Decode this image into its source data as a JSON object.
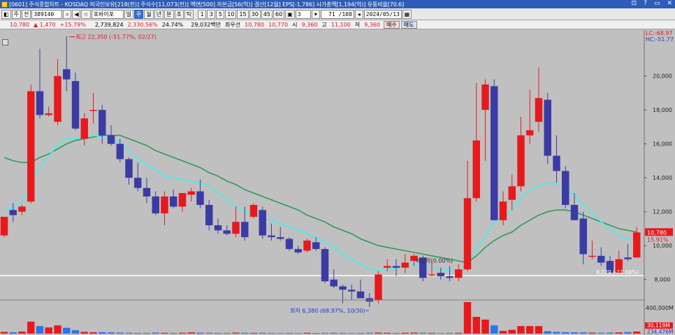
{
  "title_bar": {
    "text": "[0601] 주식종합차트 - KOSDAQ 외국인보유[218(천)] 주식수[11,073(천)] 액면[500] 자본금[56(억)] 결산[12월] EPS[-1,786] 시가총액[1,194(억)] 유통비율[70.6]",
    "controls": [
      "⊡",
      "?",
      "▭",
      "✕"
    ]
  },
  "toolbar": {
    "type_select": "주",
    "market_select": "전",
    "code": "389140",
    "search_icon": "magnifier-icon",
    "stock_name": "포바이포",
    "periods": [
      "일",
      "주",
      "월",
      "년",
      "분",
      "초",
      "틱"
    ],
    "active_period": "주",
    "intervals": [
      "1",
      "3",
      "5",
      "10",
      "15",
      "30",
      "45",
      "60"
    ],
    "interval_value": "3",
    "page_count": "71 /108",
    "date": "2024/05/13"
  },
  "quote_bar": {
    "price": "10,780",
    "change": "▲ 1,470",
    "change_pct": "+15.79%",
    "volume": "2,739,824",
    "vol_change": "2,330.56%",
    "turnover": "24.74%",
    "amount": "29,032백만",
    "label_best": "최우선",
    "best_ask": "10,780",
    "best_bid": "10,770",
    "open_label": "시",
    "open": "9,360",
    "high_label": "고",
    "high": "11,100",
    "low_label": "저",
    "low": "9,360",
    "buy_label": "매수",
    "sell_label": "매도"
  },
  "chart_data": {
    "type": "candlestick",
    "price_axis": {
      "min": 7000,
      "max": 22500,
      "ticks": [
        "20,000",
        "18,000",
        "16,000",
        "14,000",
        "12,000",
        "10,000",
        "8,000"
      ]
    },
    "volume_axis": {
      "ticks": [
        "400,000M"
      ],
      "max": 460
    },
    "annotations": {
      "high": "최고 22,350 (-51.77%, 02/27)",
      "low": "최저 6,380 (68.97%, 10/30)",
      "dividend": "배당락(0.00%)",
      "hline_label": "8,229 (-11.68%)"
    },
    "right_labels": {
      "lc": "LC:-68.97",
      "hc": "HC:-51.77",
      "current_price": "10,780",
      "current_pct": "15.91%",
      "vol_current": "30,119M",
      "vol_prev": "234,476M"
    },
    "hline_value": 8229,
    "candles": [
      {
        "o": 10600,
        "h": 11500,
        "l": 10500,
        "c": 11700
      },
      {
        "o": 12100,
        "h": 12500,
        "l": 11400,
        "c": 11800
      },
      {
        "o": 12000,
        "h": 12400,
        "l": 11800,
        "c": 12300
      },
      {
        "o": 12600,
        "h": 19500,
        "l": 12500,
        "c": 19100
      },
      {
        "o": 19100,
        "h": 21600,
        "l": 17500,
        "c": 17700
      },
      {
        "o": 17700,
        "h": 18200,
        "l": 17600,
        "c": 17800
      },
      {
        "o": 17300,
        "h": 21000,
        "l": 17100,
        "c": 20000
      },
      {
        "o": 20400,
        "h": 22350,
        "l": 19100,
        "c": 19800
      },
      {
        "o": 19700,
        "h": 20200,
        "l": 16800,
        "c": 16900
      },
      {
        "o": 16300,
        "h": 17800,
        "l": 15900,
        "c": 17500
      },
      {
        "o": 18000,
        "h": 19000,
        "l": 17200,
        "c": 18000
      },
      {
        "o": 18000,
        "h": 18300,
        "l": 16000,
        "c": 16500
      },
      {
        "o": 16500,
        "h": 17100,
        "l": 15900,
        "c": 16000
      },
      {
        "o": 16000,
        "h": 16300,
        "l": 14900,
        "c": 15100
      },
      {
        "o": 15100,
        "h": 15200,
        "l": 13600,
        "c": 14000
      },
      {
        "o": 14000,
        "h": 14900,
        "l": 13200,
        "c": 13400
      },
      {
        "o": 13400,
        "h": 14000,
        "l": 12500,
        "c": 12900
      },
      {
        "o": 12900,
        "h": 13200,
        "l": 11800,
        "c": 11900
      },
      {
        "o": 11900,
        "h": 13200,
        "l": 11200,
        "c": 12900
      },
      {
        "o": 12900,
        "h": 13300,
        "l": 12200,
        "c": 12300
      },
      {
        "o": 12300,
        "h": 13100,
        "l": 12000,
        "c": 13100
      },
      {
        "o": 13000,
        "h": 13400,
        "l": 12600,
        "c": 13200
      },
      {
        "o": 13200,
        "h": 13900,
        "l": 12200,
        "c": 12400
      },
      {
        "o": 12400,
        "h": 12700,
        "l": 10900,
        "c": 11200
      },
      {
        "o": 11200,
        "h": 11600,
        "l": 10700,
        "c": 10900
      },
      {
        "o": 10900,
        "h": 11200,
        "l": 10600,
        "c": 10700
      },
      {
        "o": 10700,
        "h": 12300,
        "l": 10500,
        "c": 11400
      },
      {
        "o": 11400,
        "h": 12300,
        "l": 10300,
        "c": 10500
      },
      {
        "o": 11700,
        "h": 12500,
        "l": 11600,
        "c": 12400
      },
      {
        "o": 12100,
        "h": 12300,
        "l": 10400,
        "c": 10600
      },
      {
        "o": 10600,
        "h": 11300,
        "l": 10300,
        "c": 10500
      },
      {
        "o": 10500,
        "h": 11100,
        "l": 10300,
        "c": 10400
      },
      {
        "o": 10400,
        "h": 10500,
        "l": 9700,
        "c": 9800
      },
      {
        "o": 9800,
        "h": 10000,
        "l": 9500,
        "c": 9600
      },
      {
        "o": 9700,
        "h": 10400,
        "l": 9600,
        "c": 10300
      },
      {
        "o": 10200,
        "h": 10500,
        "l": 9700,
        "c": 9800
      },
      {
        "o": 9800,
        "h": 9900,
        "l": 7800,
        "c": 7900
      },
      {
        "o": 8000,
        "h": 8600,
        "l": 7500,
        "c": 7600
      },
      {
        "o": 7600,
        "h": 7700,
        "l": 6600,
        "c": 7400
      },
      {
        "o": 7400,
        "h": 7700,
        "l": 6800,
        "c": 7300
      },
      {
        "o": 7300,
        "h": 8000,
        "l": 6900,
        "c": 6900
      },
      {
        "o": 6900,
        "h": 7200,
        "l": 6380,
        "c": 6700
      },
      {
        "o": 6800,
        "h": 8500,
        "l": 6600,
        "c": 8300
      },
      {
        "o": 8700,
        "h": 9200,
        "l": 8500,
        "c": 8800
      },
      {
        "o": 8800,
        "h": 9200,
        "l": 8200,
        "c": 8700
      },
      {
        "o": 8700,
        "h": 9500,
        "l": 8400,
        "c": 9000
      },
      {
        "o": 9100,
        "h": 9500,
        "l": 8800,
        "c": 9400
      },
      {
        "o": 9300,
        "h": 9400,
        "l": 7900,
        "c": 8100
      },
      {
        "o": 8300,
        "h": 9100,
        "l": 8200,
        "c": 8300
      },
      {
        "o": 8400,
        "h": 8700,
        "l": 8000,
        "c": 8200
      },
      {
        "o": 8200,
        "h": 8800,
        "l": 7900,
        "c": 8100
      },
      {
        "o": 8100,
        "h": 8900,
        "l": 7900,
        "c": 8600
      },
      {
        "o": 8600,
        "h": 15000,
        "l": 8500,
        "c": 12800
      },
      {
        "o": 12800,
        "h": 19600,
        "l": 12600,
        "c": 16200
      },
      {
        "o": 18000,
        "h": 19800,
        "l": 15000,
        "c": 19500
      },
      {
        "o": 19400,
        "h": 19800,
        "l": 11500,
        "c": 11500
      },
      {
        "o": 11500,
        "h": 13200,
        "l": 11200,
        "c": 12600
      },
      {
        "o": 12700,
        "h": 14200,
        "l": 12100,
        "c": 13500
      },
      {
        "o": 13500,
        "h": 17600,
        "l": 13200,
        "c": 16500
      },
      {
        "o": 16500,
        "h": 19200,
        "l": 16000,
        "c": 16800
      },
      {
        "o": 17300,
        "h": 20500,
        "l": 16700,
        "c": 18700
      },
      {
        "o": 18600,
        "h": 19000,
        "l": 14800,
        "c": 15300
      },
      {
        "o": 15300,
        "h": 16500,
        "l": 13700,
        "c": 14400
      },
      {
        "o": 14400,
        "h": 14700,
        "l": 12200,
        "c": 12400
      },
      {
        "o": 12400,
        "h": 13100,
        "l": 11500,
        "c": 11500
      },
      {
        "o": 11600,
        "h": 12000,
        "l": 8900,
        "c": 9500
      },
      {
        "o": 9400,
        "h": 10300,
        "l": 9200,
        "c": 9400
      },
      {
        "o": 9400,
        "h": 9900,
        "l": 8800,
        "c": 9000
      },
      {
        "o": 9100,
        "h": 9400,
        "l": 8500,
        "c": 8400
      },
      {
        "o": 8400,
        "h": 9700,
        "l": 8300,
        "c": 9200
      },
      {
        "o": 9300,
        "h": 10100,
        "l": 9100,
        "c": 9200
      },
      {
        "o": 9300,
        "h": 11100,
        "l": 9360,
        "c": 10780
      }
    ],
    "ma_fast": [
      12100,
      12200,
      12600,
      13700,
      14600,
      15300,
      15900,
      16300,
      16300,
      16400,
      16500,
      16400,
      16300,
      16100,
      15600,
      15100,
      14800,
      14500,
      14100,
      14000,
      13900,
      13800,
      13700,
      13500,
      13100,
      12700,
      12300,
      12000,
      11800,
      11600,
      11500,
      11300,
      11100,
      10900,
      10700,
      10500,
      10200,
      9900,
      9500,
      9200,
      8900,
      8600,
      8500,
      8600,
      8700,
      8800,
      8900,
      8800,
      8700,
      8600,
      8500,
      8400,
      8800,
      9900,
      10500,
      11400,
      11700,
      12100,
      12800,
      13300,
      13500,
      13700,
      13600,
      13400,
      13000,
      12400,
      11900,
      11400,
      11000,
      10600,
      10400,
      10300
    ],
    "ma_slow": [
      15200,
      15000,
      14900,
      14900,
      15200,
      15400,
      15700,
      16000,
      16200,
      16300,
      16400,
      16500,
      16500,
      16500,
      16300,
      16100,
      15900,
      15600,
      15400,
      15200,
      15000,
      14800,
      14600,
      14300,
      14100,
      13800,
      13600,
      13300,
      13100,
      12900,
      12700,
      12500,
      12300,
      12100,
      11800,
      11600,
      11400,
      11100,
      10900,
      10700,
      10400,
      10200,
      10000,
      9900,
      9800,
      9700,
      9600,
      9500,
      9400,
      9300,
      9200,
      9100,
      9000,
      9400,
      9900,
      10300,
      10600,
      10800,
      11200,
      11500,
      11800,
      12000,
      12100,
      12100,
      12000,
      11800,
      11600,
      11400,
      11200,
      11000,
      10900,
      10800
    ],
    "volume": [
      25,
      20,
      30,
      175,
      110,
      90,
      120,
      85,
      50,
      25,
      20,
      22,
      18,
      15,
      12,
      10,
      10,
      14,
      12,
      10,
      12,
      18,
      14,
      12,
      10,
      10,
      14,
      12,
      10,
      12,
      10,
      8,
      10,
      8,
      12,
      10,
      10,
      12,
      10,
      8,
      10,
      12,
      15,
      12,
      10,
      12,
      14,
      12,
      10,
      8,
      10,
      12,
      460,
      245,
      205,
      120,
      40,
      55,
      110,
      110,
      110,
      35,
      25,
      22,
      20,
      18,
      14,
      12,
      15,
      18,
      22,
      30
    ],
    "colors": {
      "up": "#e8191c",
      "down": "#3b3ba6",
      "ma_fast": "#40f0f0",
      "ma_slow": "#2e9a58",
      "hline": "#ffffff",
      "bg": "#c0c0c0"
    }
  }
}
